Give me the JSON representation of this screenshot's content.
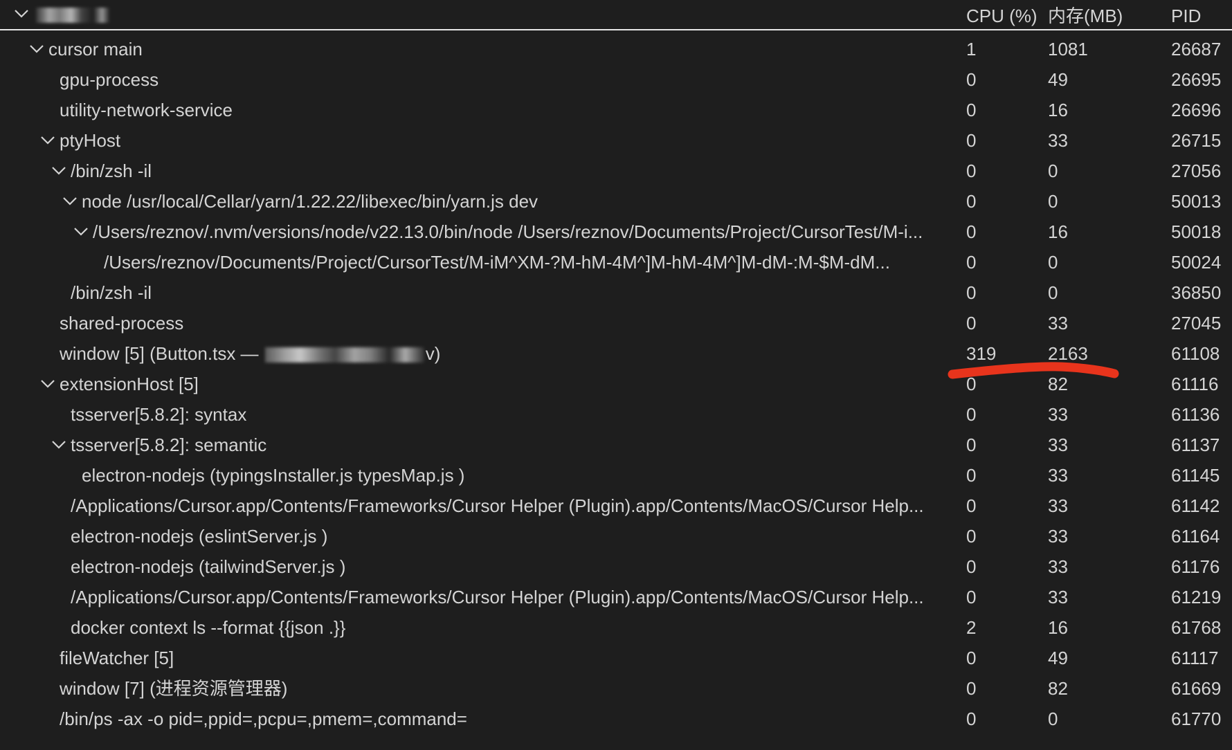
{
  "header": {
    "toggle_icon": "chevron-down-icon",
    "title": "",
    "columns": {
      "cpu": "CPU (%)",
      "mem": "内存(MB)",
      "pid": "PID"
    }
  },
  "rows": [
    {
      "depth": 0,
      "expanded": true,
      "name": "cursor main",
      "cpu": "1",
      "mem": "1081",
      "pid": "26687"
    },
    {
      "depth": 1,
      "expanded": null,
      "name": "gpu-process",
      "cpu": "0",
      "mem": "49",
      "pid": "26695"
    },
    {
      "depth": 1,
      "expanded": null,
      "name": "utility-network-service",
      "cpu": "0",
      "mem": "16",
      "pid": "26696"
    },
    {
      "depth": 1,
      "expanded": true,
      "name": "ptyHost",
      "cpu": "0",
      "mem": "33",
      "pid": "26715"
    },
    {
      "depth": 2,
      "expanded": true,
      "name": "/bin/zsh -il",
      "cpu": "0",
      "mem": "0",
      "pid": "27056"
    },
    {
      "depth": 3,
      "expanded": true,
      "name": "node /usr/local/Cellar/yarn/1.22.22/libexec/bin/yarn.js dev",
      "cpu": "0",
      "mem": "0",
      "pid": "50013"
    },
    {
      "depth": 4,
      "expanded": true,
      "name": "/Users/reznov/.nvm/versions/node/v22.13.0/bin/node /Users/reznov/Documents/Project/CursorTest/M-i...",
      "cpu": "0",
      "mem": "16",
      "pid": "50018"
    },
    {
      "depth": 5,
      "expanded": null,
      "name": "/Users/reznov/Documents/Project/CursorTest/M-iM^XM-?M-hM-4M^]M-hM-4M^]M-dM-:M-$M-dM...",
      "cpu": "0",
      "mem": "0",
      "pid": "50024"
    },
    {
      "depth": 2,
      "expanded": null,
      "name": "/bin/zsh -il",
      "cpu": "0",
      "mem": "0",
      "pid": "36850"
    },
    {
      "depth": 1,
      "expanded": null,
      "name": "shared-process",
      "cpu": "0",
      "mem": "33",
      "pid": "27045"
    },
    {
      "depth": 1,
      "expanded": null,
      "name": "window [5] (Button.tsx — ",
      "name_suffix": "v)",
      "redacted": true,
      "cpu": "319",
      "mem": "2163",
      "pid": "61108"
    },
    {
      "depth": 1,
      "expanded": true,
      "name": "extensionHost [5]",
      "cpu": "0",
      "mem": "82",
      "pid": "61116"
    },
    {
      "depth": 2,
      "expanded": null,
      "name": "tsserver[5.8.2]: syntax",
      "cpu": "0",
      "mem": "33",
      "pid": "61136"
    },
    {
      "depth": 2,
      "expanded": true,
      "name": "tsserver[5.8.2]: semantic",
      "cpu": "0",
      "mem": "33",
      "pid": "61137"
    },
    {
      "depth": 3,
      "expanded": null,
      "name": "electron-nodejs (typingsInstaller.js typesMap.js )",
      "cpu": "0",
      "mem": "33",
      "pid": "61145"
    },
    {
      "depth": 2,
      "expanded": null,
      "name": "/Applications/Cursor.app/Contents/Frameworks/Cursor Helper (Plugin).app/Contents/MacOS/Cursor Help...",
      "cpu": "0",
      "mem": "33",
      "pid": "61142"
    },
    {
      "depth": 2,
      "expanded": null,
      "name": "electron-nodejs (eslintServer.js )",
      "cpu": "0",
      "mem": "33",
      "pid": "61164"
    },
    {
      "depth": 2,
      "expanded": null,
      "name": "electron-nodejs (tailwindServer.js )",
      "cpu": "0",
      "mem": "33",
      "pid": "61176"
    },
    {
      "depth": 2,
      "expanded": null,
      "name": "/Applications/Cursor.app/Contents/Frameworks/Cursor Helper (Plugin).app/Contents/MacOS/Cursor Help...",
      "cpu": "0",
      "mem": "33",
      "pid": "61219"
    },
    {
      "depth": 2,
      "expanded": null,
      "name": "docker context ls --format {{json .}}",
      "cpu": "2",
      "mem": "16",
      "pid": "61768"
    },
    {
      "depth": 1,
      "expanded": null,
      "name": "fileWatcher [5]",
      "cpu": "0",
      "mem": "49",
      "pid": "61117"
    },
    {
      "depth": 1,
      "expanded": null,
      "name": "window [7] (进程资源管理器)",
      "cpu": "0",
      "mem": "82",
      "pid": "61669"
    },
    {
      "depth": 1,
      "expanded": null,
      "name": "/bin/ps -ax -o pid=,ppid=,pcpu=,pmem=,command=",
      "cpu": "0",
      "mem": "0",
      "pid": "61770"
    }
  ],
  "annotation": {
    "type": "red-underline",
    "color": "#e8341c",
    "highlights_row_pid": "61108"
  },
  "colors": {
    "background": "#1e1e1e",
    "text": "#d4d4d4",
    "header_border": "#e6e6e6",
    "annotation": "#e8341c"
  }
}
